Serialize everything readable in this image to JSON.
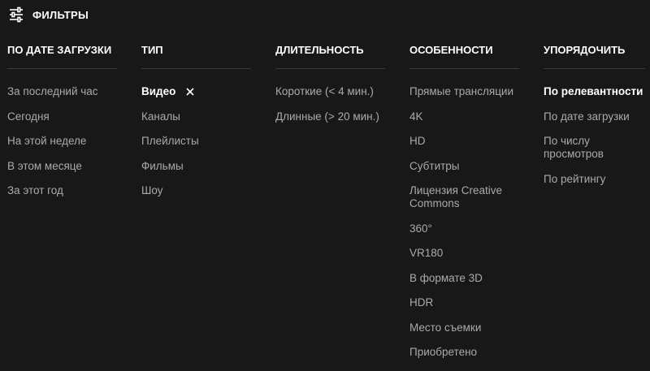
{
  "header": {
    "title": "ФИЛЬТРЫ",
    "icon": "filter-sliders-icon"
  },
  "columns": [
    {
      "title": "ПО ДАТЕ ЗАГРУЗКИ",
      "items": [
        "За последний час",
        "Сегодня",
        "На этой неделе",
        "В этом месяце",
        "За этот год"
      ]
    },
    {
      "title": "ТИП",
      "items": [
        "Видео",
        "Каналы",
        "Плейлисты",
        "Фильмы",
        "Шоу"
      ],
      "active_index": 0,
      "active_has_clear": true
    },
    {
      "title": "ДЛИТЕЛЬНОСТЬ",
      "items": [
        "Короткие (< 4 мин.)",
        "Длинные (> 20 мин.)"
      ]
    },
    {
      "title": "ОСОБЕННОСТИ",
      "items": [
        "Прямые трансляции",
        "4K",
        "HD",
        "Субтитры",
        "Лицензия Creative Commons",
        "360°",
        "VR180",
        "В формате 3D",
        "HDR",
        "Место съемки",
        "Приобретено"
      ]
    },
    {
      "title": "УПОРЯДОЧИТЬ",
      "items": [
        "По релевантности",
        "По дате загрузки",
        "По числу просмотров",
        "По рейтингу"
      ],
      "active_index": 0
    }
  ],
  "colors": {
    "background": "#181818",
    "text": "#aaaaaa",
    "active": "#ffffff",
    "divider": "#3a3a3a"
  }
}
